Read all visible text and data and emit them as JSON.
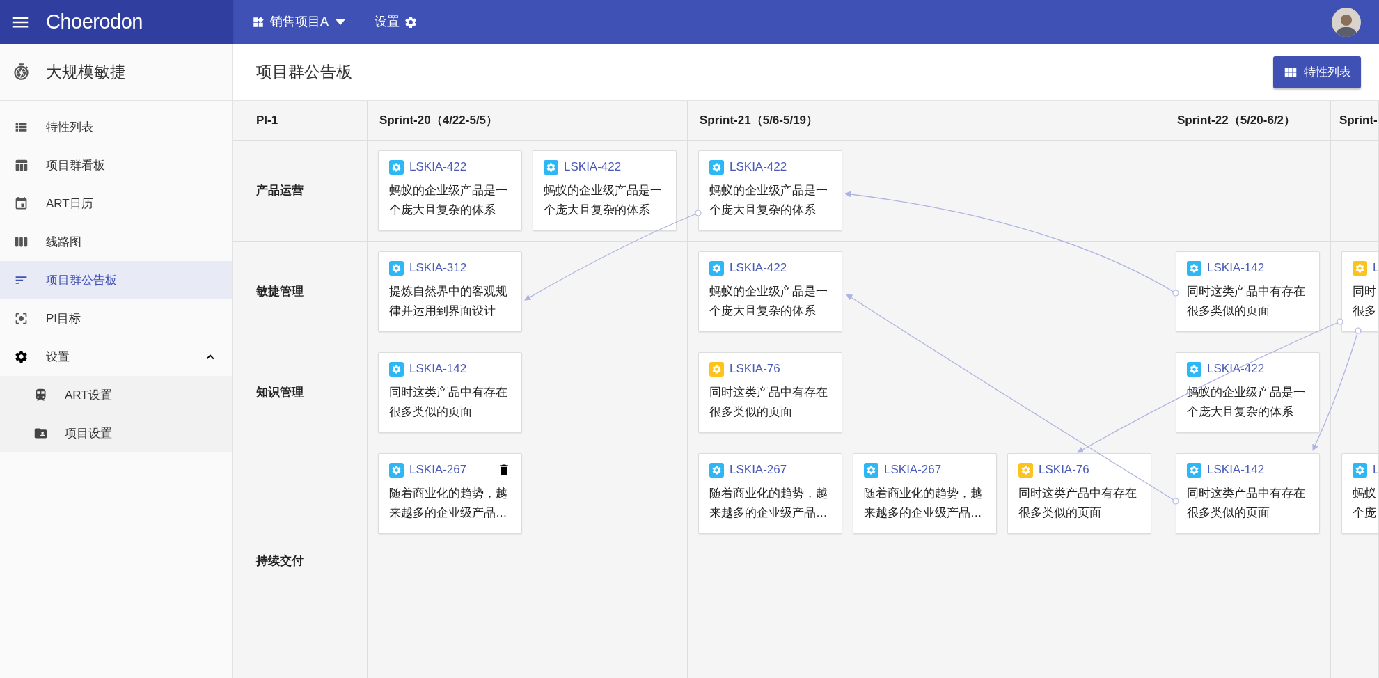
{
  "top_bar": {
    "app_name": "Choerodon",
    "project": "销售项目A",
    "settings": "设置"
  },
  "sidebar": {
    "title": "大规模敏捷",
    "items": [
      {
        "label": "特性列表",
        "selected": false
      },
      {
        "label": "项目群看板",
        "selected": false
      },
      {
        "label": "ART日历",
        "selected": false
      },
      {
        "label": "线路图",
        "selected": false
      },
      {
        "label": "项目群公告板",
        "selected": true
      },
      {
        "label": "PI目标",
        "selected": false
      },
      {
        "label": "设置",
        "selected": false,
        "expanded": true,
        "children": [
          {
            "label": "ART设置",
            "selected": false
          },
          {
            "label": "项目设置",
            "selected": false
          }
        ]
      }
    ]
  },
  "page": {
    "title": "项目群公告板",
    "action_button": "特性列表"
  },
  "board": {
    "pi": "PI-1",
    "sprints": [
      "Sprint-20（4/22-5/5）",
      "Sprint-21（5/6-5/19）",
      "Sprint-22（5/20-6/2）",
      "Sprint-"
    ],
    "rows": [
      {
        "name": "产品运营",
        "cells": [
          [
            {
              "id": "LSKIA-422",
              "color": "#2db7f5",
              "show_delete": false,
              "lines": [
                "蚂蚁的企业级产品是一",
                "个庞大且复杂的体系"
              ]
            },
            {
              "id": "LSKIA-422",
              "color": "#2db7f5",
              "show_delete": false,
              "lines": [
                "蚂蚁的企业级产品是一",
                "个庞大且复杂的体系"
              ]
            }
          ],
          [
            {
              "id": "LSKIA-422",
              "color": "#2db7f5",
              "show_delete": false,
              "lines": [
                "蚂蚁的企业级产品是一",
                "个庞大且复杂的体系"
              ]
            }
          ],
          [],
          []
        ]
      },
      {
        "name": "敏捷管理",
        "cells": [
          [
            {
              "id": "LSKIA-312",
              "color": "#2db7f5",
              "show_delete": false,
              "lines": [
                "提炼自然界中的客观规",
                "律并运用到界面设计"
              ]
            }
          ],
          [
            {
              "id": "LSKIA-422",
              "color": "#2db7f5",
              "show_delete": false,
              "lines": [
                "蚂蚁的企业级产品是一",
                "个庞大且复杂的体系"
              ]
            }
          ],
          [
            {
              "id": "LSKIA-142",
              "color": "#2db7f5",
              "show_delete": false,
              "lines": [
                "同时这类产品中有存在",
                "很多类似的页面"
              ]
            }
          ],
          [
            {
              "id": "L",
              "color": "#fcc31f",
              "show_delete": false,
              "lines": [
                "同时",
                "很多"
              ]
            }
          ]
        ]
      },
      {
        "name": "知识管理",
        "cells": [
          [
            {
              "id": "LSKIA-142",
              "color": "#2db7f5",
              "show_delete": false,
              "lines": [
                "同时这类产品中有存在",
                "很多类似的页面"
              ]
            }
          ],
          [
            {
              "id": "LSKIA-76",
              "color": "#fcc31f",
              "show_delete": false,
              "lines": [
                "同时这类产品中有存在",
                "很多类似的页面"
              ]
            }
          ],
          [
            {
              "id": "LSKIA-422",
              "color": "#2db7f5",
              "show_delete": false,
              "lines": [
                "蚂蚁的企业级产品是一",
                "个庞大且复杂的体系"
              ]
            }
          ],
          []
        ]
      },
      {
        "name": "持续交付",
        "cells": [
          [
            {
              "id": "LSKIA-267",
              "color": "#2db7f5",
              "show_delete": true,
              "lines": [
                "随着商业化的趋势，越",
                "来越多的企业级产品…"
              ]
            }
          ],
          [
            {
              "id": "LSKIA-267",
              "color": "#2db7f5",
              "show_delete": false,
              "lines": [
                "随着商业化的趋势，越",
                "来越多的企业级产品…"
              ]
            },
            {
              "id": "LSKIA-267",
              "color": "#2db7f5",
              "show_delete": false,
              "lines": [
                "随着商业化的趋势，越",
                "来越多的企业级产品…"
              ]
            },
            {
              "id": "LSKIA-76",
              "color": "#fcc31f",
              "show_delete": false,
              "lines": [
                "同时这类产品中有存在",
                "很多类似的页面"
              ]
            }
          ],
          [
            {
              "id": "LSKIA-142",
              "color": "#2db7f5",
              "show_delete": false,
              "lines": [
                "同时这类产品中有存在",
                "很多类似的页面"
              ]
            }
          ],
          [
            {
              "id": "L",
              "color": "#2db7f5",
              "show_delete": false,
              "lines": [
                "蚂蚁",
                "个庞"
              ]
            }
          ]
        ]
      }
    ]
  }
}
